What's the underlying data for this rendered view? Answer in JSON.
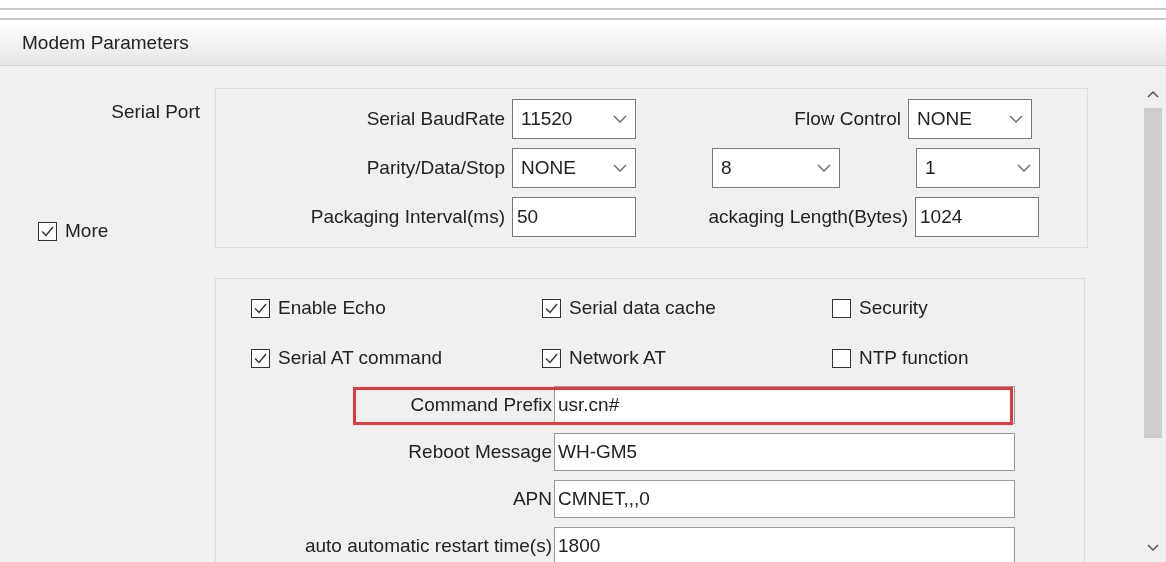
{
  "panel": {
    "title": "Modem Parameters"
  },
  "serial_port": {
    "label": "Serial Port",
    "rows": [
      {
        "items": [
          {
            "kind": "label",
            "text": "Serial BaudRate"
          },
          {
            "kind": "select",
            "value": "11520"
          },
          {
            "kind": "label",
            "text": "Flow Control"
          },
          {
            "kind": "select",
            "value": "NONE"
          }
        ]
      },
      {
        "items": [
          {
            "kind": "label",
            "text": "Parity/Data/Stop"
          },
          {
            "kind": "select",
            "value": "NONE"
          },
          {
            "kind": "select",
            "value": "8"
          },
          {
            "kind": "select",
            "value": "1"
          }
        ]
      },
      {
        "items": [
          {
            "kind": "label",
            "text": "Packaging Interval(ms)"
          },
          {
            "kind": "input",
            "value": "50"
          },
          {
            "kind": "label",
            "text": "ackaging Length(Bytes)"
          },
          {
            "kind": "input",
            "value": "1024"
          }
        ]
      }
    ]
  },
  "more": {
    "label": "More",
    "checked": true
  },
  "options": [
    {
      "label": "Enable Echo",
      "checked": true
    },
    {
      "label": "Serial data cache",
      "checked": true
    },
    {
      "label": "Security",
      "checked": false
    },
    {
      "label": "Serial AT command",
      "checked": true
    },
    {
      "label": "Network AT",
      "checked": true
    },
    {
      "label": "NTP function",
      "checked": false
    }
  ],
  "fields": [
    {
      "label": "Command Prefix",
      "value": "usr.cn#",
      "highlighted": true
    },
    {
      "label": "Reboot Message",
      "value": "WH-GM5",
      "highlighted": false
    },
    {
      "label": "APN",
      "value": "CMNET,,,0",
      "highlighted": false
    },
    {
      "label": "auto automatic restart time(s)",
      "value": "1800",
      "highlighted": false
    }
  ]
}
